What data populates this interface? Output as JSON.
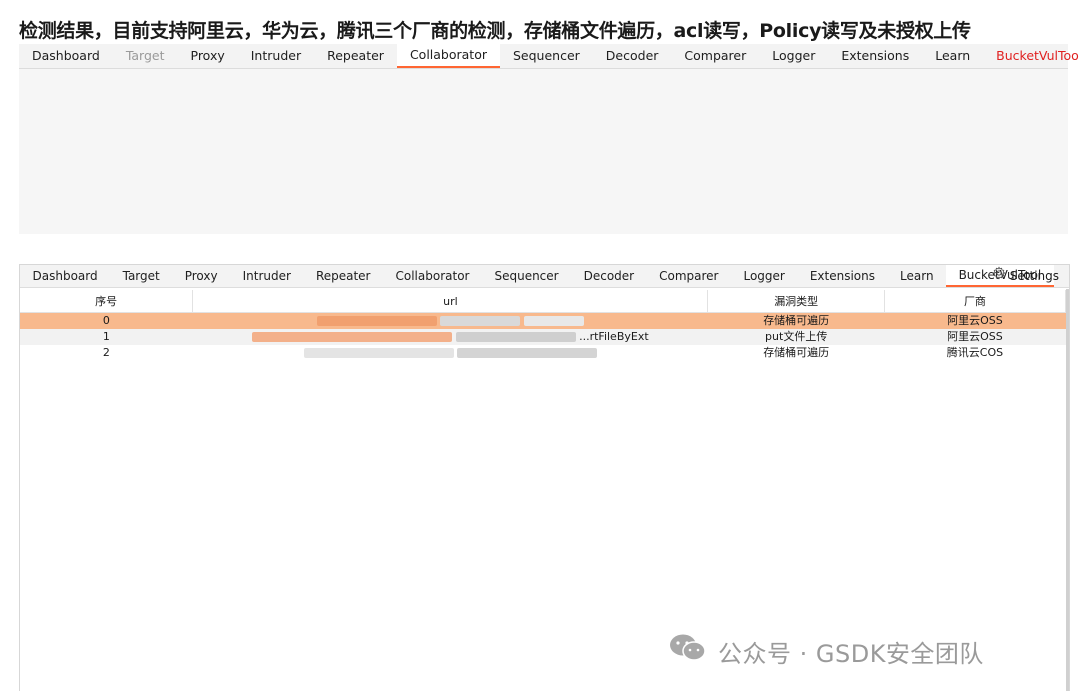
{
  "heading": "检测结果，目前支持阿里云，华为云，腾讯三个厂商的检测，存储桶文件遍历，acl读写，Policy读写及未授权上传",
  "top_tabs": [
    "Dashboard",
    "Target",
    "Proxy",
    "Intruder",
    "Repeater",
    "Collaborator",
    "Sequencer",
    "Decoder",
    "Comparer",
    "Logger",
    "Extensions",
    "Learn",
    "BucketVulTool"
  ],
  "bottom_tabs": [
    "Dashboard",
    "Target",
    "Proxy",
    "Intruder",
    "Repeater",
    "Collaborator",
    "Sequencer",
    "Decoder",
    "Comparer",
    "Logger",
    "Extensions",
    "Learn",
    "BucketVulTool"
  ],
  "settings_label": "Settings",
  "table": {
    "headers": [
      "序号",
      "url",
      "漏洞类型",
      "厂商"
    ],
    "rows": [
      {
        "index": "0",
        "url_visible": "",
        "vuln": "存储桶可遍历",
        "vendor": "阿里云OSS"
      },
      {
        "index": "1",
        "url_visible": "...rtFileByExt",
        "vuln": "put文件上传",
        "vendor": "阿里云OSS"
      },
      {
        "index": "2",
        "url_visible": "",
        "vuln": "存储桶可遍历",
        "vendor": "腾讯云COS"
      }
    ]
  },
  "watermark": "公众号 · GSDK安全团队",
  "colors": {
    "accent": "#ff6633",
    "selected_row": "#f8b98d",
    "highlight_tab": "#e02020"
  }
}
